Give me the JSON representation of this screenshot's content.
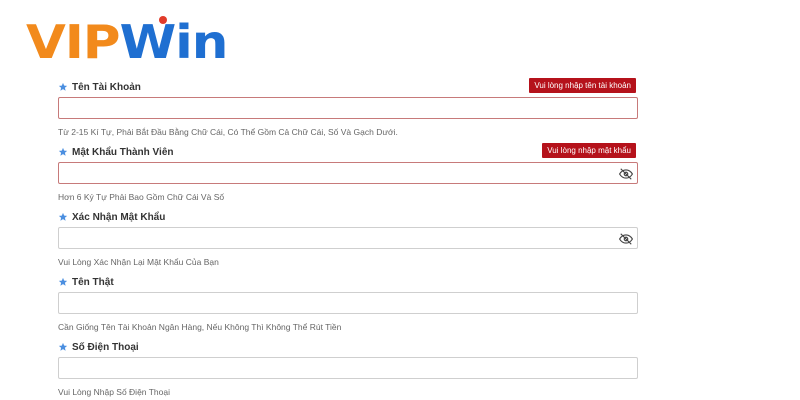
{
  "logo": {
    "vip": "VIP",
    "win": "Win"
  },
  "fields": [
    {
      "label": "Tên Tài Khoản",
      "error": "Vui lòng nhập tên tài khoản",
      "hint": "Từ 2-15 Kí Tự, Phải Bắt Đầu Bằng Chữ Cái, Có Thể Gồm Cả Chữ Cái, Số Và Gạch Dưới.",
      "value": ""
    },
    {
      "label": "Mật Khẩu Thành Viên",
      "error": "Vui lòng nhập mật khẩu",
      "hint": "Hơn 6 Ký Tự Phải Bao Gồm Chữ Cái Và Số",
      "value": "",
      "icon": "eye-slash-icon"
    },
    {
      "label": "Xác Nhận Mật Khẩu",
      "hint": "Vui Lòng Xác Nhận Lại Mật Khẩu Của Bạn",
      "value": "",
      "icon": "eye-slash-icon"
    },
    {
      "label": "Tên Thật",
      "hint": "Cần Giống Tên Tài Khoản Ngân Hàng, Nếu Không Thì Không Thể Rút Tiền",
      "value": ""
    },
    {
      "label": "Số Điện Thoại",
      "hint": "Vui Lòng Nhập Số Điện Thoại",
      "value": ""
    }
  ],
  "colors": {
    "star": "#4b8fe0",
    "error_bg": "#b5121b",
    "logo_orange": "#f28a1c",
    "logo_blue": "#1f6fd1"
  }
}
